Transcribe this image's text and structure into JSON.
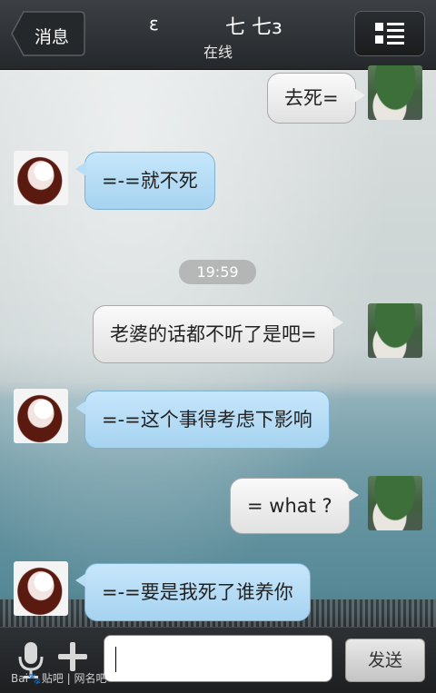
{
  "header": {
    "back_label": "消息",
    "title_left": "ε",
    "title_main": "七 七ɜ",
    "status": "在线"
  },
  "messages": [
    {
      "side": "right",
      "text": "去死="
    },
    {
      "side": "left",
      "text": "=-=就不死"
    },
    {
      "side": "right",
      "text": "老婆的话都不听了是吧="
    },
    {
      "side": "left",
      "text": "=-=这个事得考虑下影响"
    },
    {
      "side": "right",
      "text": "= what ?"
    },
    {
      "side": "left",
      "text": "=-=要是我死了谁养你"
    }
  ],
  "timestamp": "19:59",
  "input": {
    "value": "",
    "send_label": "发送"
  },
  "watermark": "Bai🐾贴吧 | 网名吧",
  "colors": {
    "header": "#2a2d30",
    "bubble_left": "#b8ddf5",
    "bubble_right": "#ececec"
  }
}
